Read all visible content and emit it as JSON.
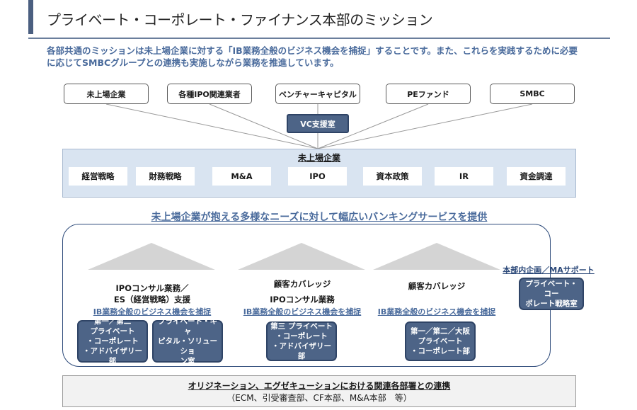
{
  "header": {
    "title": "プライベート・コーポレート・ファイナンス本部のミッション",
    "intro_line1": "各部共通のミッションは未上場企業に対する「IB業務全般のビジネス機会を捕捉」することです。また、これらを実践するために必要",
    "intro_line2": "に応じてSMBCグループとの連携も実施しながら業務を推進しています。"
  },
  "stakeholders": [
    "未上場企業",
    "各種IPO関連業者",
    "ベンチャーキャピタル",
    "PEファンド",
    "SMBC"
  ],
  "vc_support": "VC支援室",
  "client_band": {
    "title": "未上場企業",
    "needs": [
      "経営戦略",
      "財務戦略",
      "M&A",
      "IPO",
      "資本政策",
      "IR",
      "資金調達"
    ]
  },
  "banner": "未上場企業が抱える多様なニーズに対して幅広いバンキングサービスを提供",
  "groups": [
    {
      "service_lines": [
        "IPOコンサル業務／",
        "ES（経営戦略）支援"
      ],
      "capture": "IB業務全般のビジネス機会を捕捉",
      "depts": [
        [
          "第一／第二",
          "プライベート",
          "・コーポレート",
          "・アドバイザリー部"
        ],
        [
          "プライベート・キャ",
          "ピタル・ソリューショ",
          "ン室"
        ]
      ]
    },
    {
      "service_lines": [
        "顧客カバレッジ",
        "IPOコンサル業務"
      ],
      "capture": "IB業務全般のビジネス機会を捕捉",
      "depts": [
        [
          "第三 プライベート",
          "・コーポレート",
          "・アドバイザリー部"
        ]
      ]
    },
    {
      "service_lines": [
        "顧客カバレッジ"
      ],
      "capture": "IB業務全般のビジネス機会を捕捉",
      "depts": [
        [
          "第一／第二／大阪",
          "プライベート",
          "・コーポレート部"
        ]
      ]
    }
  ],
  "side": {
    "label": "本部内企画／MAサポート",
    "dept": [
      "プライベート・コー",
      "ポレート戦略室"
    ]
  },
  "bottom": {
    "title": "オリジネーション、エグゼキューションにおける関連各部署との連携",
    "subtitle": "（ECM、引受審査部、CF本部、M&A本部　等）"
  },
  "colors": {
    "accent": "#4a6b9c",
    "dept_fill": "#4d6487",
    "band_fill": "#d9e4f1"
  }
}
